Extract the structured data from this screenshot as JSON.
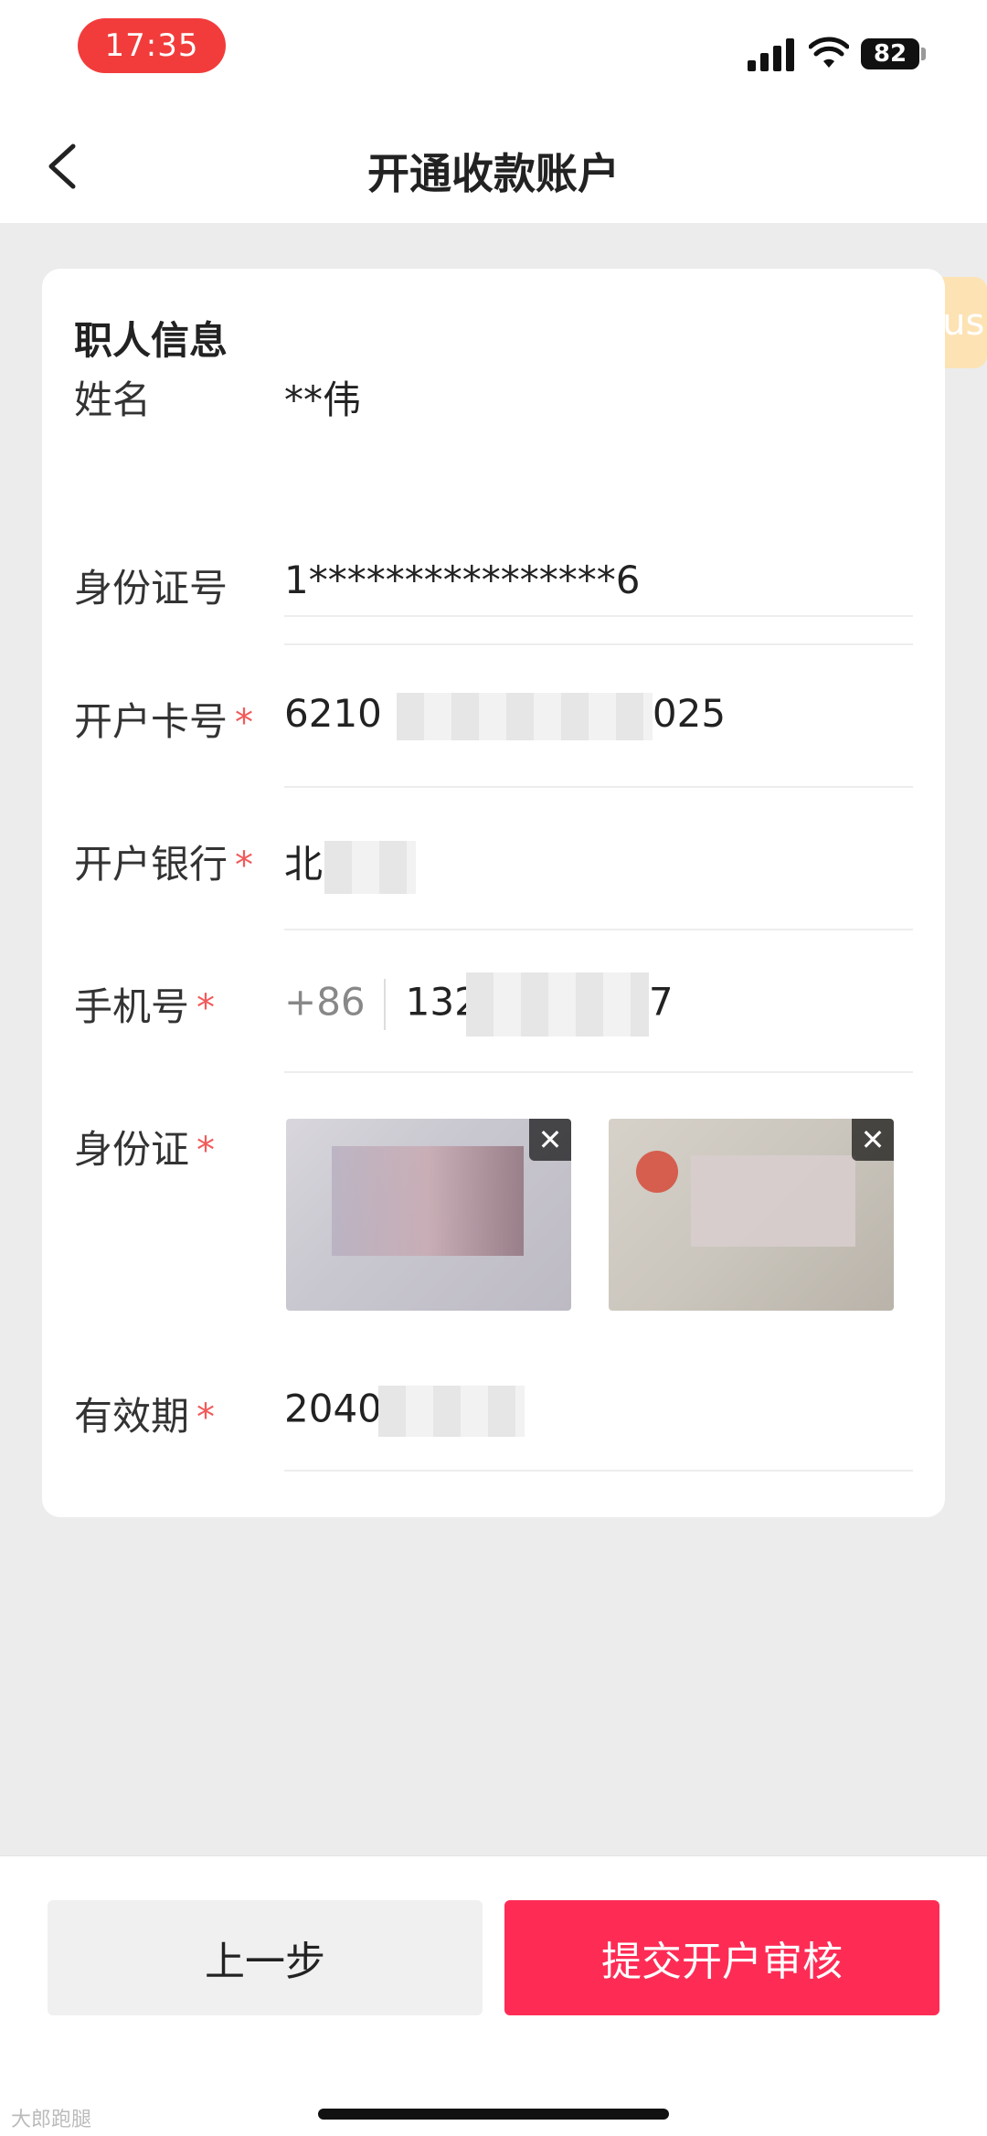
{
  "status_bar": {
    "time": "17:35",
    "battery": "82",
    "signal_icon": "signal-bars-icon",
    "wifi_icon": "wifi-icon"
  },
  "nav": {
    "title": "开通收款账户",
    "back_icon": "chevron-left-icon"
  },
  "card": {
    "section_title": "职人信息",
    "debug_tag": "ppe_craftsman_account_status",
    "fields": {
      "name": {
        "label": "姓名",
        "value": "**伟"
      },
      "id_number": {
        "label": "身份证号",
        "value": "1****************6"
      },
      "card_number": {
        "label": "开户卡号",
        "required": "*",
        "value_start": "6210",
        "value_end": "025"
      },
      "bank": {
        "label": "开户银行",
        "required": "*",
        "value_start": "北京"
      },
      "phone": {
        "label": "手机号",
        "required": "*",
        "prefix": "+86",
        "value_start": "132",
        "value_end": "7"
      },
      "id_card": {
        "label": "身份证",
        "required": "*",
        "remove_symbol": "✕"
      },
      "validity": {
        "label": "有效期",
        "required": "*",
        "value_start": "2040"
      }
    }
  },
  "actions": {
    "prev_label": "上一步",
    "submit_label": "提交开户审核"
  },
  "watermark": "大郎跑腿",
  "colors": {
    "accent": "#fe2c55",
    "required": "#f25a5a",
    "time_pill": "#f23c3c",
    "tag_bg": "#fde2b4"
  }
}
